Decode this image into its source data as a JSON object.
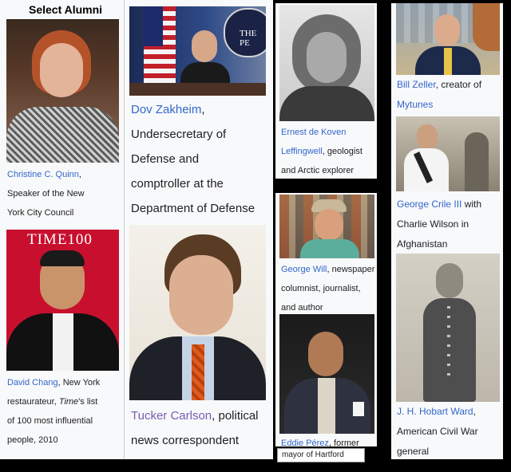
{
  "heading": "Select Alumni",
  "alumni": {
    "quinn": {
      "name": "Christine C. Quinn",
      "line1": "Speaker of the New",
      "line2": "York City Council"
    },
    "chang": {
      "name": "David Chang",
      "after_name": ", New York",
      "line1": "restaurateur, ",
      "line1_italic": "Time",
      "line1_rest": "'s list",
      "line2": "of 100 most influential",
      "line3": "people, 2010",
      "photo_text": "TIME100"
    },
    "zakheim": {
      "name": "Dov Zakheim",
      "line0_rest": ",",
      "line1": "Undersecretary of",
      "line2": "Defense and",
      "line3": "comptroller at the",
      "line4": "Department of Defense",
      "photo_text": "THE PE"
    },
    "carlson": {
      "name": "Tucker Carlson",
      "after_name": ", political",
      "line1": "news correspondent"
    },
    "leffingwell": {
      "name_part1": "Ernest de Koven",
      "name_part2": "Leffingwell",
      "after_name": ", geologist",
      "line1": "and Arctic explorer"
    },
    "will": {
      "name": "George Will",
      "after_name": ", newspaper",
      "line1": "columnist, journalist,",
      "line2": "and author"
    },
    "perez": {
      "name": "Eddie Pérez",
      "after_name": ", former",
      "line1": "mayor of Hartford"
    },
    "zeller": {
      "name": "Bill Zeller",
      "after_name": ", creator of",
      "line1_link": "Mytunes"
    },
    "crile": {
      "name": "George Crile III",
      "after_name": " with",
      "line1": "Charlie Wilson in",
      "line2": "Afghanistan"
    },
    "ward": {
      "name": "J. H. Hobart Ward",
      "after_name": ",",
      "line1": "American Civil War",
      "line2": "general"
    }
  }
}
